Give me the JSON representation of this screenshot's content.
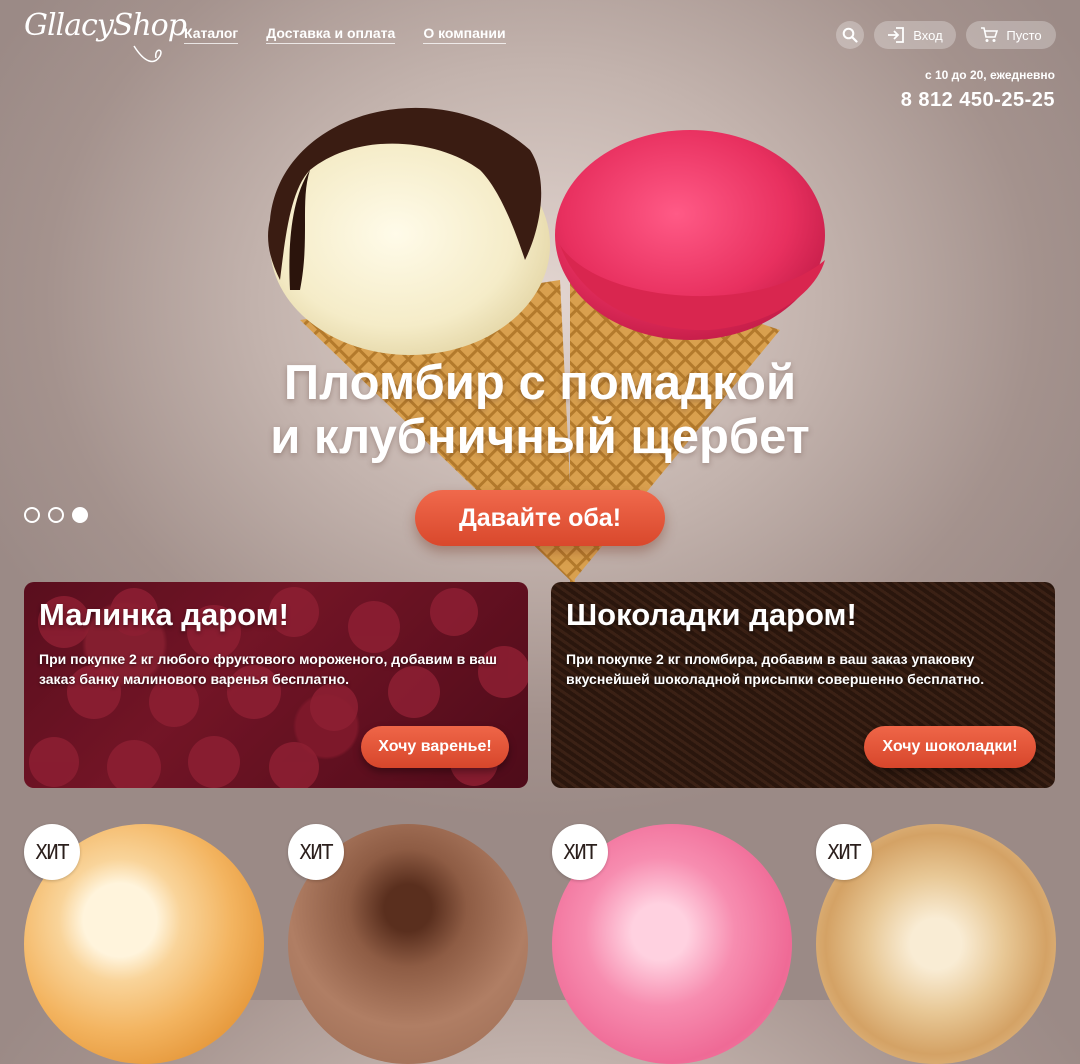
{
  "header": {
    "logo": "GllacyShop",
    "nav": [
      "Каталог",
      "Доставка и оплата",
      "О компании"
    ],
    "login_label": "Вход",
    "cart_label": "Пусто",
    "hours": "с 10 до 20, ежедневно",
    "phone": "8 812 450-25-25"
  },
  "hero": {
    "title_line1": "Пломбир с помадкой",
    "title_line2": "и клубничный щербет",
    "cta": "Давайте оба!",
    "slides_total": 3,
    "active_slide": 3
  },
  "promos": [
    {
      "title": "Малинка даром!",
      "text": "При покупке 2 кг любого фруктового мороженого, добавим в ваш заказ банку малинового варенья бесплатно.",
      "button": "Хочу варенье!"
    },
    {
      "title": "Шоколадки даром!",
      "text": "При покупке 2 кг пломбира, добавим в ваш заказ упаковку вкуснейшей шоколадной присыпки совершенно бесплатно.",
      "button": "Хочу шоколадки!"
    }
  ],
  "products": [
    {
      "badge": "ХИТ"
    },
    {
      "badge": "ХИТ"
    },
    {
      "badge": "ХИТ"
    },
    {
      "badge": "ХИТ"
    }
  ],
  "colors": {
    "accent": "#e3553a",
    "background": "#b3a19c"
  }
}
